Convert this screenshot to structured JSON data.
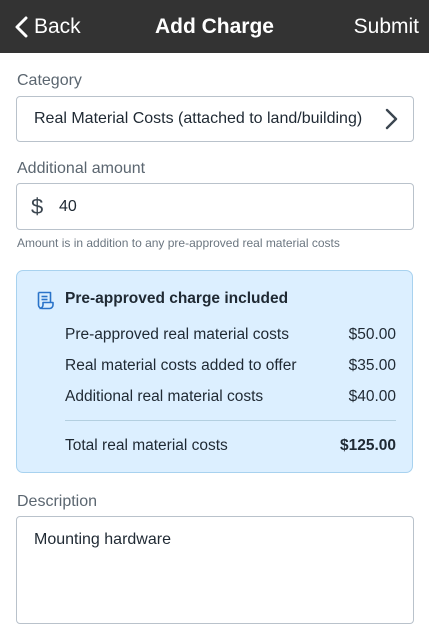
{
  "header": {
    "back_label": "Back",
    "title": "Add Charge",
    "submit_label": "Submit"
  },
  "category": {
    "label": "Category",
    "value": "Real Material Costs (attached to land/building)"
  },
  "amount": {
    "label": "Additional amount",
    "currency_symbol": "$",
    "value": "40",
    "hint": "Amount is in addition to any pre-approved real material costs"
  },
  "summary": {
    "title": "Pre-approved charge included",
    "rows": [
      {
        "label": "Pre-approved real material costs",
        "amount": "$50.00"
      },
      {
        "label": "Real material costs added to offer",
        "amount": "$35.00"
      },
      {
        "label": "Additional real material costs",
        "amount": "$40.00"
      }
    ],
    "total_label": "Total real material costs",
    "total_amount": "$125.00"
  },
  "description": {
    "label": "Description",
    "value": "Mounting hardware"
  },
  "colors": {
    "navbar": "#333333",
    "card_bg": "#dcefff",
    "card_border": "#a8d2ef",
    "accent_icon": "#2a73c9"
  }
}
